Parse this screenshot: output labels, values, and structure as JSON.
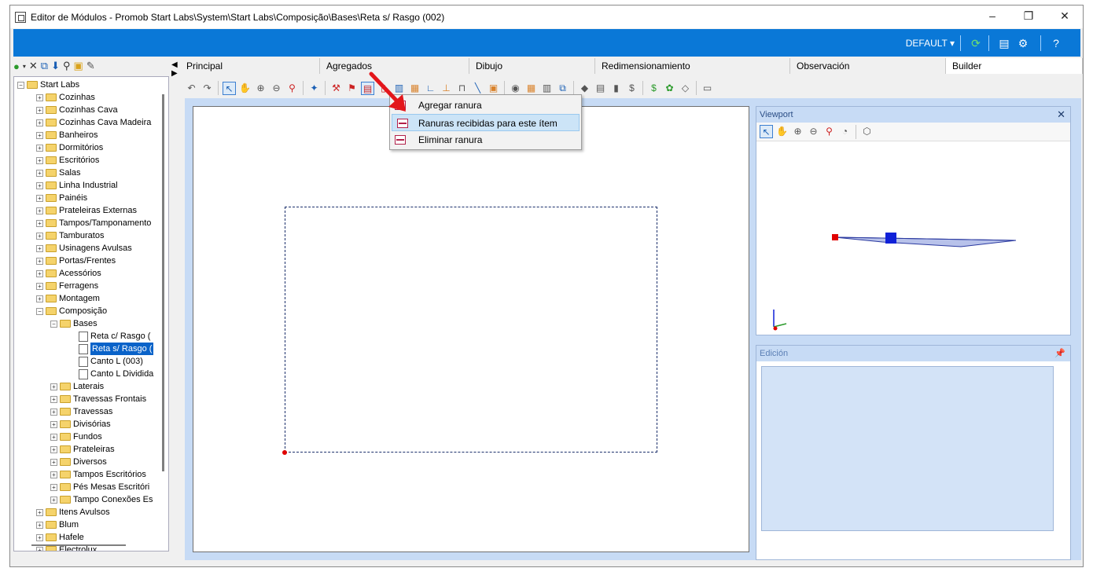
{
  "window": {
    "title": "Editor de Módulos - Promob Start Labs\\System\\Start Labs\\Composição\\Bases\\Reta s/ Rasgo (002)",
    "controls": [
      "–",
      "❐",
      "✕"
    ]
  },
  "ribbon": {
    "profile": "DEFAULT ▾"
  },
  "tree": {
    "root": "Start Labs",
    "items": [
      {
        "label": "Cozinhas"
      },
      {
        "label": "Cozinhas Cava"
      },
      {
        "label": "Cozinhas Cava Madeira"
      },
      {
        "label": "Banheiros"
      },
      {
        "label": "Dormitórios"
      },
      {
        "label": "Escritórios"
      },
      {
        "label": "Salas"
      },
      {
        "label": "Linha Industrial"
      },
      {
        "label": "Painéis"
      },
      {
        "label": "Prateleiras Externas"
      },
      {
        "label": "Tampos/Tamponamento"
      },
      {
        "label": "Tamburatos"
      },
      {
        "label": "Usinagens Avulsas"
      },
      {
        "label": "Portas/Frentes"
      },
      {
        "label": "Acessórios"
      },
      {
        "label": "Ferragens"
      },
      {
        "label": "Montagem"
      },
      {
        "label": "Composição"
      }
    ],
    "bases": "Bases",
    "base_items": [
      "Reta c/ Rasgo (",
      "Reta s/ Rasgo (",
      "Canto L (003)",
      "Canto L Dividida"
    ],
    "comp_items": [
      "Laterais",
      "Travessas Frontais",
      "Travessas",
      "Divisórias",
      "Fundos",
      "Prateleiras",
      "Diversos",
      "Tampos Escritórios",
      "Pés Mesas Escritóri",
      "Tampo Conexões Es"
    ],
    "tail_items": [
      "Itens Avulsos",
      "Blum",
      "Hafele",
      "Electrolux"
    ]
  },
  "tabs": [
    "Principal",
    "Agregados",
    "Dibujo",
    "Redimensionamiento",
    "Observación",
    "Builder"
  ],
  "menu": {
    "items": [
      "Agregar ranura",
      "Ranuras recibidas para este ítem",
      "Eliminar ranura"
    ]
  },
  "panels": {
    "viewport": "Viewport",
    "edicion": "Edición"
  }
}
